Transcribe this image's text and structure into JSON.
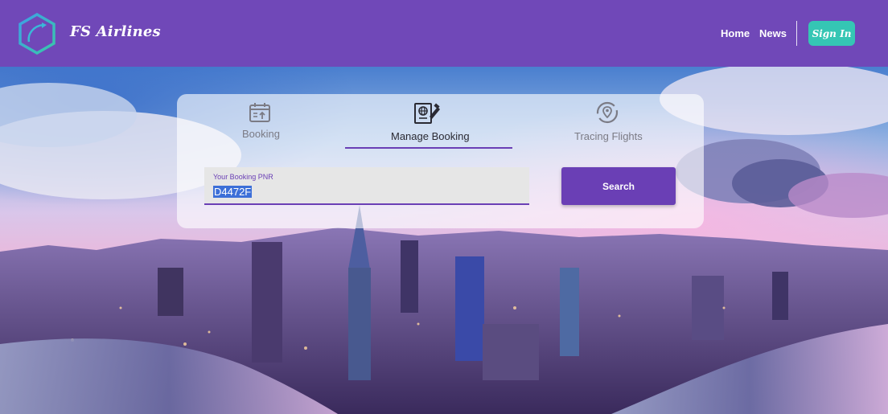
{
  "header": {
    "brand": "FS Airlines",
    "logo_icon": "plane-hexagon-logo-icon",
    "nav": [
      {
        "label": "Home"
      },
      {
        "label": "News"
      }
    ],
    "signin_label": "Sign In"
  },
  "booking_panel": {
    "tabs": [
      {
        "label": "Booking",
        "icon": "calendar-upload-icon",
        "active": false
      },
      {
        "label": "Manage Booking",
        "icon": "globe-document-icon",
        "active": true
      },
      {
        "label": "Tracing Flights",
        "icon": "location-pin-circle-icon",
        "active": false
      }
    ],
    "pnr_field": {
      "label": "Your Booking PNR",
      "value": "D4472F"
    },
    "search_label": "Search"
  },
  "colors": {
    "header": "#7048b8",
    "accent": "#6a3fb5",
    "signin": "#35c6b4"
  }
}
